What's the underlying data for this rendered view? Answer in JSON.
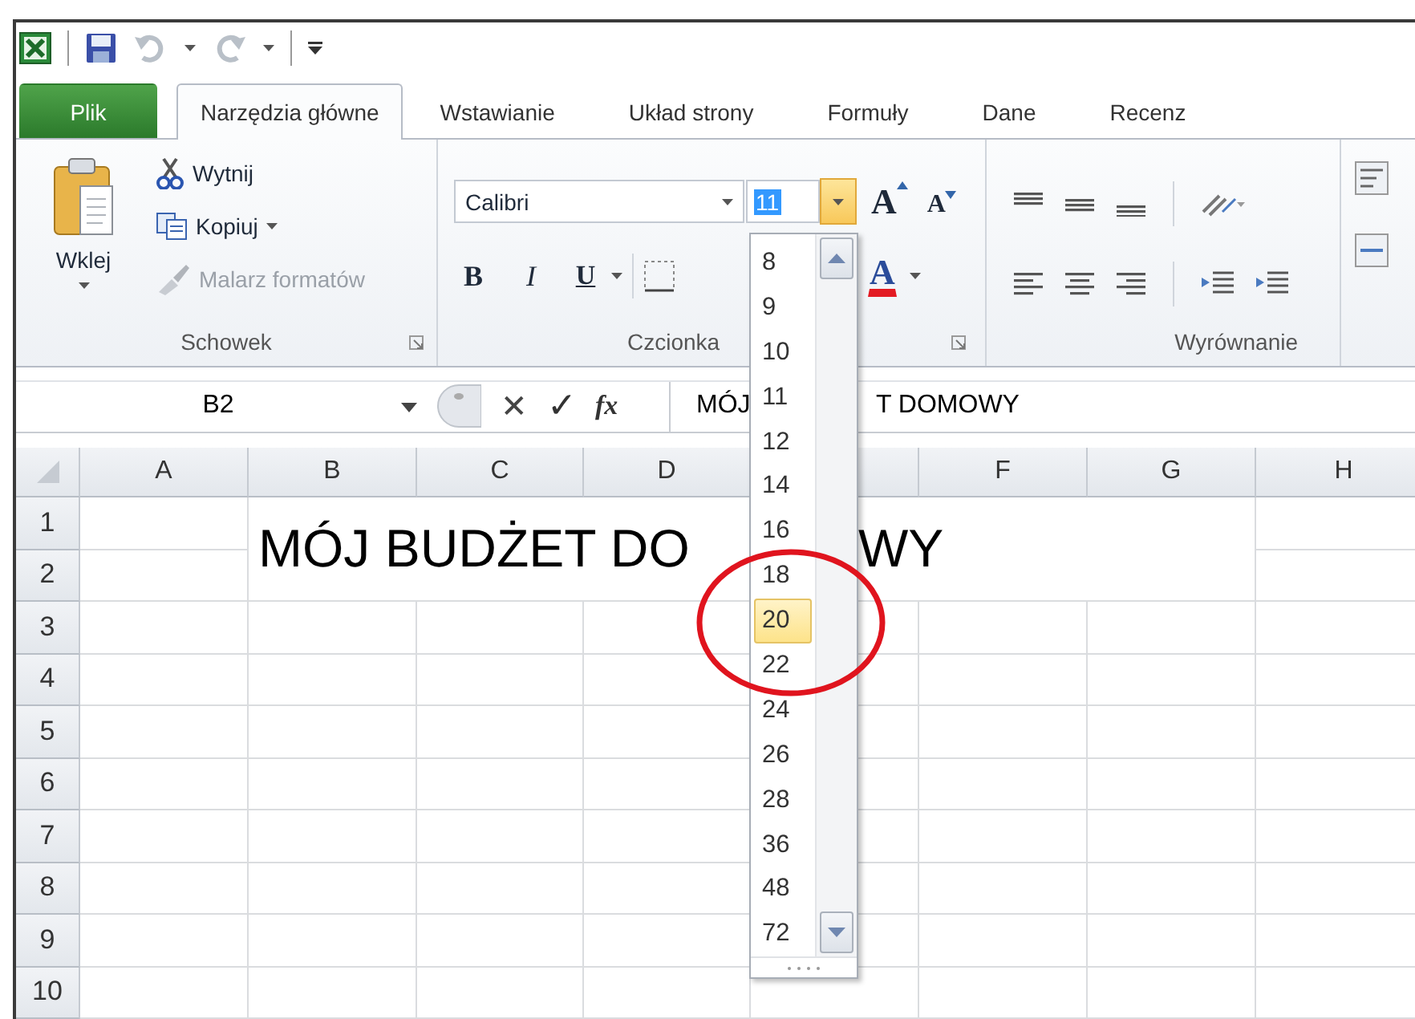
{
  "tabs": [
    {
      "label": "Plik",
      "kind": "file",
      "selected": false
    },
    {
      "label": "Narzędzia główne",
      "kind": "tab",
      "selected": true
    },
    {
      "label": "Wstawianie",
      "kind": "tab",
      "selected": false
    },
    {
      "label": "Układ strony",
      "kind": "tab",
      "selected": false
    },
    {
      "label": "Formuły",
      "kind": "tab",
      "selected": false
    },
    {
      "label": "Dane",
      "kind": "tab",
      "selected": false
    },
    {
      "label": "Recenz",
      "kind": "tab",
      "selected": false
    }
  ],
  "ribbon": {
    "clipboard": {
      "paste": "Wklej",
      "cut": "Wytnij",
      "copy": "Kopiuj",
      "format_painter": {
        "label": "Malarz formatów",
        "disabled": true
      },
      "group_label": "Schowek"
    },
    "font": {
      "font_name": "Calibri",
      "font_size": "11",
      "grow": "A",
      "shrink": "A",
      "bold": "B",
      "italic": "I",
      "underline": "U",
      "font_color": "A",
      "group_label": "Czcionka"
    },
    "alignment": {
      "group_label": "Wyrównanie"
    }
  },
  "formula_bar": {
    "name_box": "B2",
    "cancel": "✕",
    "enter": "✓",
    "function": "fx",
    "formula_parts": [
      "MÓJ",
      "T DOMOWY"
    ]
  },
  "sheet": {
    "columns": [
      {
        "label": "A"
      },
      {
        "label": "B"
      },
      {
        "label": "C"
      },
      {
        "label": "D"
      },
      {
        "covered": true
      },
      {
        "label": "F"
      },
      {
        "label": "G"
      },
      {
        "label": "H"
      }
    ],
    "rows": [
      "1",
      "2",
      "3",
      "4",
      "5",
      "6",
      "7",
      "8",
      "9",
      "10"
    ],
    "title_parts": [
      "MÓJ BUDŻET DO",
      "WY"
    ]
  },
  "font_size_list": {
    "items": [
      {
        "label": "8",
        "selected": false
      },
      {
        "label": "9",
        "selected": false
      },
      {
        "label": "10",
        "selected": false
      },
      {
        "label": "11",
        "selected": false
      },
      {
        "label": "12",
        "selected": false
      },
      {
        "label": "14",
        "selected": false
      },
      {
        "label": "16",
        "selected": false
      },
      {
        "label": "18",
        "selected": false
      },
      {
        "label": "20",
        "selected": true
      },
      {
        "label": "22",
        "selected": false
      },
      {
        "label": "24",
        "selected": false
      },
      {
        "label": "26",
        "selected": false
      },
      {
        "label": "28",
        "selected": false
      },
      {
        "label": "36",
        "selected": false
      },
      {
        "label": "48",
        "selected": false
      },
      {
        "label": "72",
        "selected": false
      }
    ]
  },
  "annotations": [
    {
      "kind": "circle"
    }
  ]
}
